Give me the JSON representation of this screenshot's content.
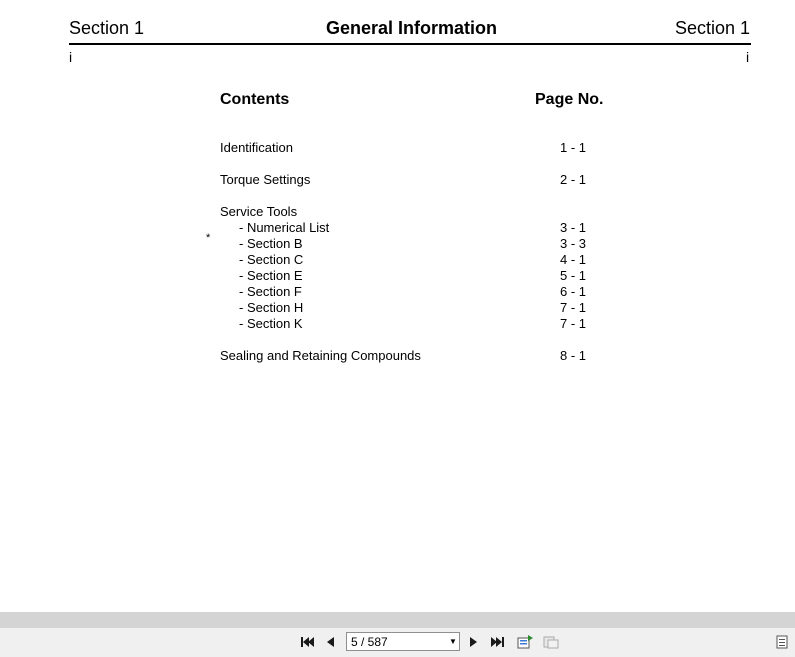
{
  "header": {
    "left": "Section 1",
    "title": "General Information",
    "right": "Section 1",
    "roman_left": "i",
    "roman_right": "i"
  },
  "toc": {
    "contents_label": "Contents",
    "page_label": "Page No.",
    "star": "*",
    "entries": [
      {
        "label": "Identification",
        "page": "1 - 1"
      },
      {
        "label": "Torque Settings",
        "page": "2 - 1"
      },
      {
        "label": "Service Tools",
        "page": ""
      },
      {
        "label": "- Numerical List",
        "page": "3 - 1"
      },
      {
        "label": "- Section B",
        "page": "3 - 3"
      },
      {
        "label": "- Section C",
        "page": "4 - 1"
      },
      {
        "label": "- Section E",
        "page": "5 - 1"
      },
      {
        "label": "- Section F",
        "page": "6 - 1"
      },
      {
        "label": "- Section H",
        "page": "7 - 1"
      },
      {
        "label": "- Section K",
        "page": "7 - 1"
      },
      {
        "label": "Sealing and Retaining Compounds",
        "page": "8 - 1"
      }
    ]
  },
  "toolbar": {
    "page_value": "5 / 587",
    "icons": [
      "first-page-icon",
      "prev-page-icon",
      "next-page-icon",
      "last-page-icon",
      "fit-page-icon",
      "print-icon",
      "sidebar-icon"
    ]
  }
}
